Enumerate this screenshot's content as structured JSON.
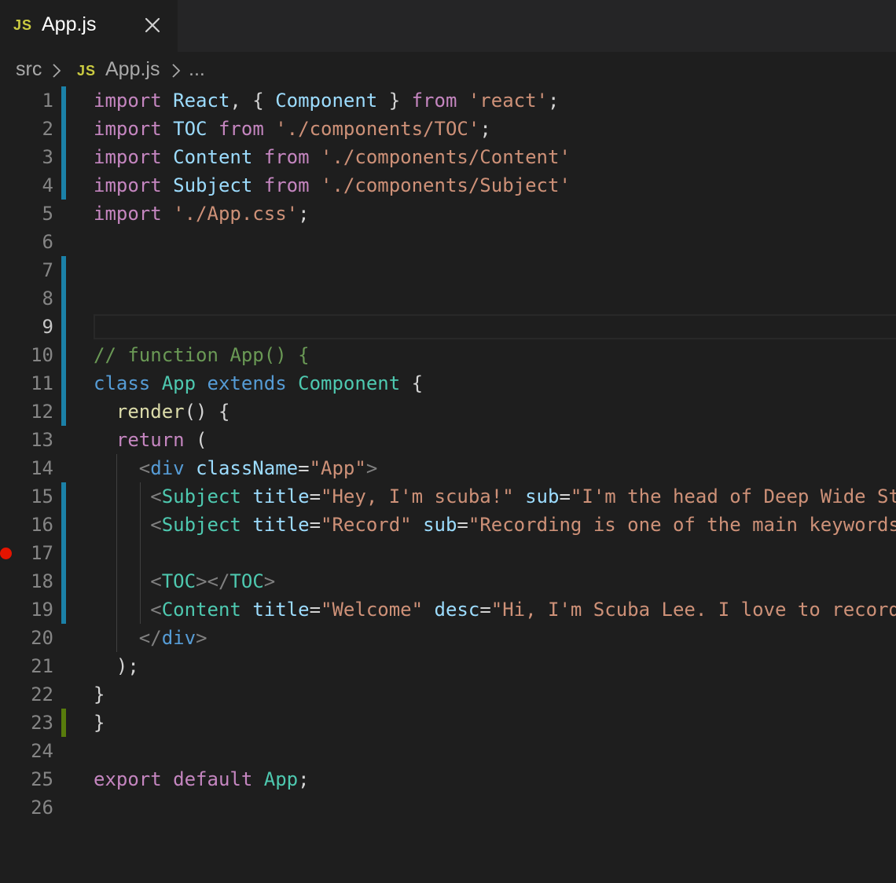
{
  "colors": {
    "keyword": "#c586c0",
    "variable": "#9cdcfe",
    "type": "#4ec9b0",
    "string": "#ce9178",
    "comment": "#6a9955",
    "plain": "#d4d4d4",
    "function": "#dcdcaa",
    "tag_punct": "#808080",
    "html_tag": "#569cd6",
    "storage": "#569cd6"
  },
  "tab": {
    "icon": "js-file-icon",
    "badge": "JS",
    "label": "App.js",
    "close_icon": "close-icon"
  },
  "breadcrumb": {
    "folder": "src",
    "badge": "JS",
    "file": "App.js",
    "ellipsis": "...",
    "separator_icon": "chevron-right-icon"
  },
  "editor": {
    "current_line": 9,
    "breakpoint_line": 17,
    "lines": [
      {
        "n": "1",
        "gutter": "mod",
        "tokens": [
          [
            "import",
            "keyword"
          ],
          [
            " ",
            "plain"
          ],
          [
            "React",
            "variable"
          ],
          [
            ", { ",
            "plain"
          ],
          [
            "Component",
            "variable"
          ],
          [
            " } ",
            "plain"
          ],
          [
            "from",
            "keyword"
          ],
          [
            " ",
            "plain"
          ],
          [
            "'react'",
            "string"
          ],
          [
            ";",
            "plain"
          ]
        ]
      },
      {
        "n": "2",
        "gutter": "mod",
        "tokens": [
          [
            "import",
            "keyword"
          ],
          [
            " ",
            "plain"
          ],
          [
            "TOC",
            "variable"
          ],
          [
            " ",
            "plain"
          ],
          [
            "from",
            "keyword"
          ],
          [
            " ",
            "plain"
          ],
          [
            "'./components/TOC'",
            "string"
          ],
          [
            ";",
            "plain"
          ]
        ]
      },
      {
        "n": "3",
        "gutter": "mod",
        "tokens": [
          [
            "import",
            "keyword"
          ],
          [
            " ",
            "plain"
          ],
          [
            "Content",
            "variable"
          ],
          [
            " ",
            "plain"
          ],
          [
            "from",
            "keyword"
          ],
          [
            " ",
            "plain"
          ],
          [
            "'./components/Content'",
            "string"
          ]
        ]
      },
      {
        "n": "4",
        "gutter": "mod",
        "tokens": [
          [
            "import",
            "keyword"
          ],
          [
            " ",
            "plain"
          ],
          [
            "Subject",
            "variable"
          ],
          [
            " ",
            "plain"
          ],
          [
            "from",
            "keyword"
          ],
          [
            " ",
            "plain"
          ],
          [
            "'./components/Subject'",
            "string"
          ]
        ]
      },
      {
        "n": "5",
        "gutter": "",
        "tokens": [
          [
            "import",
            "keyword"
          ],
          [
            " ",
            "plain"
          ],
          [
            "'./App.css'",
            "string"
          ],
          [
            ";",
            "plain"
          ]
        ]
      },
      {
        "n": "6",
        "gutter": "",
        "tokens": []
      },
      {
        "n": "7",
        "gutter": "mod",
        "tokens": []
      },
      {
        "n": "8",
        "gutter": "mod",
        "tokens": []
      },
      {
        "n": "9",
        "gutter": "mod",
        "tokens": []
      },
      {
        "n": "10",
        "gutter": "mod",
        "tokens": [
          [
            "// function App() {",
            "comment"
          ]
        ]
      },
      {
        "n": "11",
        "gutter": "mod",
        "tokens": [
          [
            "class",
            "storage"
          ],
          [
            " ",
            "plain"
          ],
          [
            "App",
            "type"
          ],
          [
            " ",
            "plain"
          ],
          [
            "extends",
            "storage"
          ],
          [
            " ",
            "plain"
          ],
          [
            "Component",
            "type"
          ],
          [
            " {",
            "plain"
          ]
        ]
      },
      {
        "n": "12",
        "gutter": "mod",
        "tokens": [
          [
            "  ",
            "plain"
          ],
          [
            "render",
            "function"
          ],
          [
            "() {",
            "plain"
          ]
        ]
      },
      {
        "n": "13",
        "gutter": "",
        "tokens": [
          [
            "  ",
            "plain"
          ],
          [
            "return",
            "keyword"
          ],
          [
            " (",
            "plain"
          ]
        ]
      },
      {
        "n": "14",
        "gutter": "",
        "tokens": [
          [
            "    ",
            "plain"
          ],
          [
            "<",
            "tag_punct"
          ],
          [
            "div",
            "html_tag"
          ],
          [
            " ",
            "plain"
          ],
          [
            "className",
            "variable"
          ],
          [
            "=",
            "plain"
          ],
          [
            "\"App\"",
            "string"
          ],
          [
            ">",
            "tag_punct"
          ]
        ]
      },
      {
        "n": "15",
        "gutter": "mod",
        "tokens": [
          [
            "     ",
            "plain"
          ],
          [
            "<",
            "tag_punct"
          ],
          [
            "Subject",
            "type"
          ],
          [
            " ",
            "plain"
          ],
          [
            "title",
            "variable"
          ],
          [
            "=",
            "plain"
          ],
          [
            "\"Hey, I'm scuba!\"",
            "string"
          ],
          [
            " ",
            "plain"
          ],
          [
            "sub",
            "variable"
          ],
          [
            "=",
            "plain"
          ],
          [
            "\"I'm the head of Deep Wide St",
            "string"
          ]
        ]
      },
      {
        "n": "16",
        "gutter": "mod",
        "tokens": [
          [
            "     ",
            "plain"
          ],
          [
            "<",
            "tag_punct"
          ],
          [
            "Subject",
            "type"
          ],
          [
            " ",
            "plain"
          ],
          [
            "title",
            "variable"
          ],
          [
            "=",
            "plain"
          ],
          [
            "\"Record\"",
            "string"
          ],
          [
            " ",
            "plain"
          ],
          [
            "sub",
            "variable"
          ],
          [
            "=",
            "plain"
          ],
          [
            "\"Recording is one of the main keywords",
            "string"
          ]
        ]
      },
      {
        "n": "17",
        "gutter": "mod",
        "tokens": []
      },
      {
        "n": "18",
        "gutter": "mod",
        "tokens": [
          [
            "     ",
            "plain"
          ],
          [
            "<",
            "tag_punct"
          ],
          [
            "TOC",
            "type"
          ],
          [
            "></",
            "tag_punct"
          ],
          [
            "TOC",
            "type"
          ],
          [
            ">",
            "tag_punct"
          ]
        ]
      },
      {
        "n": "19",
        "gutter": "mod",
        "tokens": [
          [
            "     ",
            "plain"
          ],
          [
            "<",
            "tag_punct"
          ],
          [
            "Content",
            "type"
          ],
          [
            " ",
            "plain"
          ],
          [
            "title",
            "variable"
          ],
          [
            "=",
            "plain"
          ],
          [
            "\"Welcome\"",
            "string"
          ],
          [
            " ",
            "plain"
          ],
          [
            "desc",
            "variable"
          ],
          [
            "=",
            "plain"
          ],
          [
            "\"Hi, I'm Scuba Lee. I love to record",
            "string"
          ]
        ]
      },
      {
        "n": "20",
        "gutter": "",
        "tokens": [
          [
            "    ",
            "plain"
          ],
          [
            "</",
            "tag_punct"
          ],
          [
            "div",
            "html_tag"
          ],
          [
            ">",
            "tag_punct"
          ]
        ]
      },
      {
        "n": "21",
        "gutter": "",
        "tokens": [
          [
            "  );",
            "plain"
          ]
        ]
      },
      {
        "n": "22",
        "gutter": "",
        "tokens": [
          [
            "}",
            "plain"
          ]
        ]
      },
      {
        "n": "23",
        "gutter": "add",
        "tokens": [
          [
            "}",
            "plain"
          ]
        ]
      },
      {
        "n": "24",
        "gutter": "",
        "tokens": []
      },
      {
        "n": "25",
        "gutter": "",
        "tokens": [
          [
            "export",
            "keyword"
          ],
          [
            " ",
            "plain"
          ],
          [
            "default",
            "keyword"
          ],
          [
            " ",
            "plain"
          ],
          [
            "App",
            "type"
          ],
          [
            ";",
            "plain"
          ]
        ]
      },
      {
        "n": "26",
        "gutter": "",
        "tokens": []
      }
    ]
  }
}
